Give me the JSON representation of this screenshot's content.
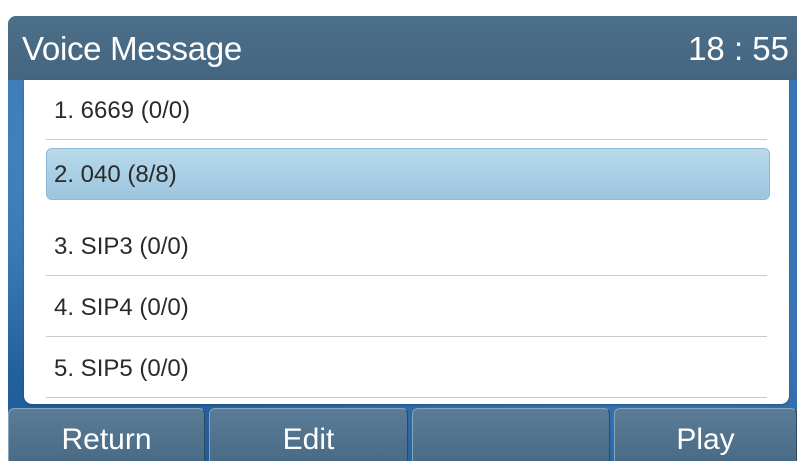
{
  "header": {
    "title": "Voice Message",
    "time": "18 : 55"
  },
  "list": {
    "selected_index": 1,
    "items": [
      {
        "label": "1. 6669  (0/0)"
      },
      {
        "label": "2. 040  (8/8)"
      },
      {
        "label": "3. SIP3  (0/0)"
      },
      {
        "label": "4. SIP4  (0/0)"
      },
      {
        "label": "5. SIP5  (0/0)"
      }
    ]
  },
  "softkeys": {
    "key1": "Return",
    "key2": "Edit",
    "key3": "",
    "key4": "Play"
  },
  "colors": {
    "title_bar": "#4c6f8a",
    "selection": "#a8cee4",
    "background": "#2a6aa8"
  }
}
